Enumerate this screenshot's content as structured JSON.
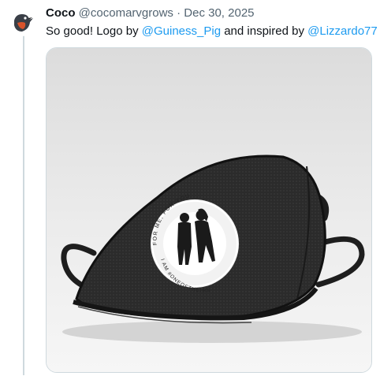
{
  "tweet": {
    "author_name": "Coco",
    "author_handle": "@cocomarvgrows",
    "separator": "·",
    "date": "Dec 30, 2025",
    "text_part1": "So good! Logo by ",
    "mention1": "@Guiness_Pig",
    "text_part2": " and inspired by ",
    "mention2": "@Lizzardo77",
    "avatar_icon": "bird-avatar-icon",
    "accent_color": "#1d9bf0"
  },
  "media": {
    "logo_text_top": "FOR ME, FOR YOU",
    "logo_text_bottom": "I AM #ONEOFTHEIRS"
  }
}
